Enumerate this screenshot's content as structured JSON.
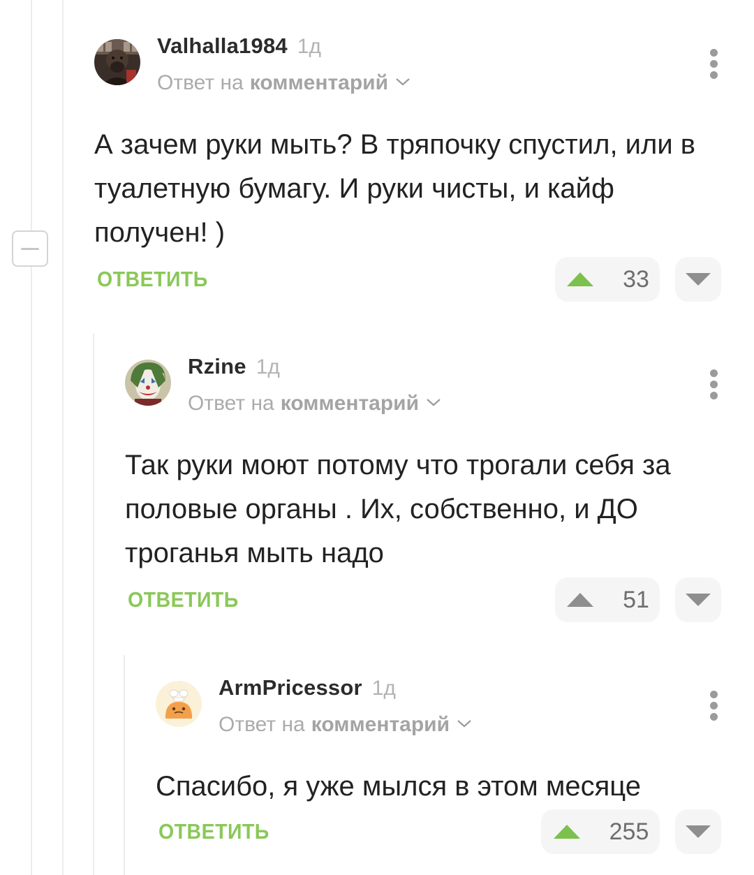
{
  "colors": {
    "accent_green": "#8ac858",
    "vote_up_active": "#7cc04e",
    "vote_up_inactive": "#8e8e8e",
    "text": "#222222",
    "muted": "#ababab"
  },
  "comments": [
    {
      "author": "Valhalla1984",
      "time": "1д",
      "reply_prefix": "Ответ на",
      "reply_link": "комментарий",
      "text": "А зачем руки мыть? В тряпочку спустил, или в туалетную бумагу. И руки чисты, и кайф получен! )",
      "reply_label": "ОТВЕТИТЬ",
      "rating": "33",
      "avatar_icon": "capybara-avatar"
    },
    {
      "author": "Rzine",
      "time": "1д",
      "reply_prefix": "Ответ на",
      "reply_link": "комментарий",
      "text": "Так руки моют потому что трогали себя за половые органы . Их, собственно, и ДО троганья мыть надо",
      "reply_label": "ОТВЕТИТЬ",
      "rating": "51",
      "avatar_icon": "joker-avatar"
    },
    {
      "author": "ArmPricessor",
      "time": "1д",
      "reply_prefix": "Ответ на",
      "reply_link": "комментарий",
      "text": "Спасибо, я уже мылся в этом месяце",
      "reply_label": "ОТВЕТИТЬ",
      "rating": "255",
      "avatar_icon": "chef-avatar"
    }
  ]
}
